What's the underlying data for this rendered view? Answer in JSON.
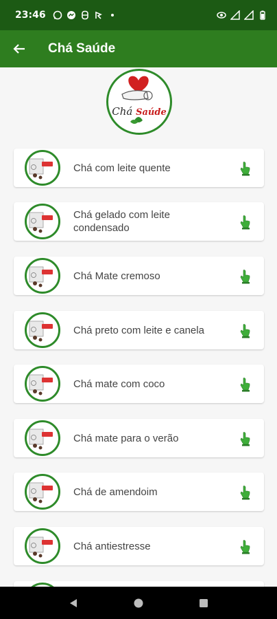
{
  "status_bar": {
    "time": "23:46",
    "notification_icons": [
      "whatsapp-icon",
      "messenger-icon",
      "app-icon",
      "app-icon-2",
      "dot-icon"
    ],
    "system_icons": [
      "eye-icon",
      "signal-icon",
      "signal-icon-2",
      "battery-icon"
    ]
  },
  "app_bar": {
    "title": "Chá Saúde",
    "back_icon": "arrow-left-icon"
  },
  "logo": {
    "cha": "Chá",
    "saude": "Saúde"
  },
  "recipes": [
    {
      "label": "Chá com leite quente"
    },
    {
      "label": "Chá gelado com leite condensado"
    },
    {
      "label": "Chá Mate cremoso"
    },
    {
      "label": "Chá preto com leite e canela"
    },
    {
      "label": "Chá mate com coco"
    },
    {
      "label": "Chá mate para o verão"
    },
    {
      "label": "Chá de amendoim"
    },
    {
      "label": "Chá antiestresse"
    }
  ],
  "colors": {
    "status_bar": "#1c5a14",
    "app_bar": "#2e7d1f",
    "accent_green": "#2e8b2a",
    "brand_red": "#c81d1d"
  },
  "nav_bar": {
    "buttons": [
      "back-triangle-icon",
      "home-circle-icon",
      "recents-square-icon"
    ]
  }
}
